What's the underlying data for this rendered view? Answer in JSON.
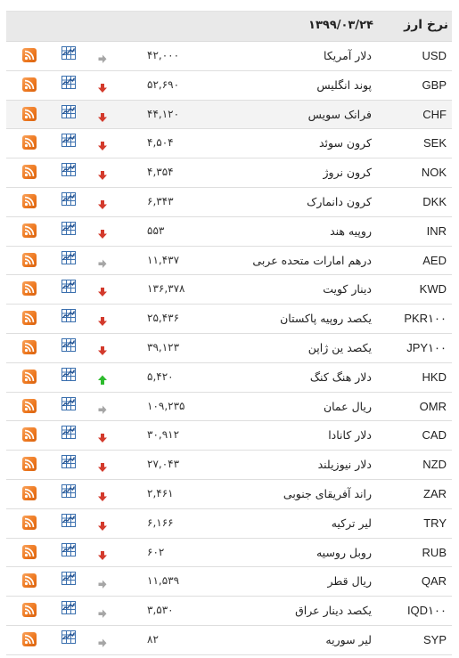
{
  "header": {
    "title": "نرخ ارز",
    "date": "۱۳۹۹/۰۳/۲۴"
  },
  "colors": {
    "up": "#2dbb2d",
    "down": "#d33a2c",
    "flat": "#a6a6a6",
    "rss": "#ee7a22",
    "chart": "#3a6fae"
  },
  "rows": [
    {
      "code": "USD",
      "name": "دلار آمریکا",
      "price": "۴۲,۰۰۰",
      "trend": "flat"
    },
    {
      "code": "GBP",
      "name": "پوند انگلیس",
      "price": "۵۲,۶۹۰",
      "trend": "down"
    },
    {
      "code": "CHF",
      "name": "فرانک سویس",
      "price": "۴۴,۱۲۰",
      "trend": "down"
    },
    {
      "code": "SEK",
      "name": "کرون سوئد",
      "price": "۴,۵۰۴",
      "trend": "down"
    },
    {
      "code": "NOK",
      "name": "کرون نروژ",
      "price": "۴,۳۵۴",
      "trend": "down"
    },
    {
      "code": "DKK",
      "name": "کرون دانمارک",
      "price": "۶,۳۴۳",
      "trend": "down"
    },
    {
      "code": "INR",
      "name": "روپیه هند",
      "price": "۵۵۳",
      "trend": "down"
    },
    {
      "code": "AED",
      "name": "درهم امارات متحده عربی",
      "price": "۱۱,۴۳۷",
      "trend": "flat"
    },
    {
      "code": "KWD",
      "name": "دینار کویت",
      "price": "۱۳۶,۳۷۸",
      "trend": "down"
    },
    {
      "code": "PKR۱۰۰",
      "name": "یکصد روپیه پاکستان",
      "price": "۲۵,۴۳۶",
      "trend": "down"
    },
    {
      "code": "JPY۱۰۰",
      "name": "یکصد ین ژاپن",
      "price": "۳۹,۱۲۳",
      "trend": "down"
    },
    {
      "code": "HKD",
      "name": "دلار هنگ کنگ",
      "price": "۵,۴۲۰",
      "trend": "up"
    },
    {
      "code": "OMR",
      "name": "ریال عمان",
      "price": "۱۰۹,۲۳۵",
      "trend": "flat"
    },
    {
      "code": "CAD",
      "name": "دلار کانادا",
      "price": "۳۰,۹۱۲",
      "trend": "down"
    },
    {
      "code": "NZD",
      "name": "دلار نیوزیلند",
      "price": "۲۷,۰۴۳",
      "trend": "down"
    },
    {
      "code": "ZAR",
      "name": "راند آفریقای جنوبی",
      "price": "۲,۴۶۱",
      "trend": "down"
    },
    {
      "code": "TRY",
      "name": "لیر ترکیه",
      "price": "۶,۱۶۶",
      "trend": "down"
    },
    {
      "code": "RUB",
      "name": "روبل روسیه",
      "price": "۶۰۲",
      "trend": "down"
    },
    {
      "code": "QAR",
      "name": "ریال قطر",
      "price": "۱۱,۵۳۹",
      "trend": "flat"
    },
    {
      "code": "IQD۱۰۰",
      "name": "یکصد دینار عراق",
      "price": "۳,۵۳۰",
      "trend": "flat"
    },
    {
      "code": "SYP",
      "name": "لیر سوریه",
      "price": "۸۲",
      "trend": "flat"
    }
  ]
}
